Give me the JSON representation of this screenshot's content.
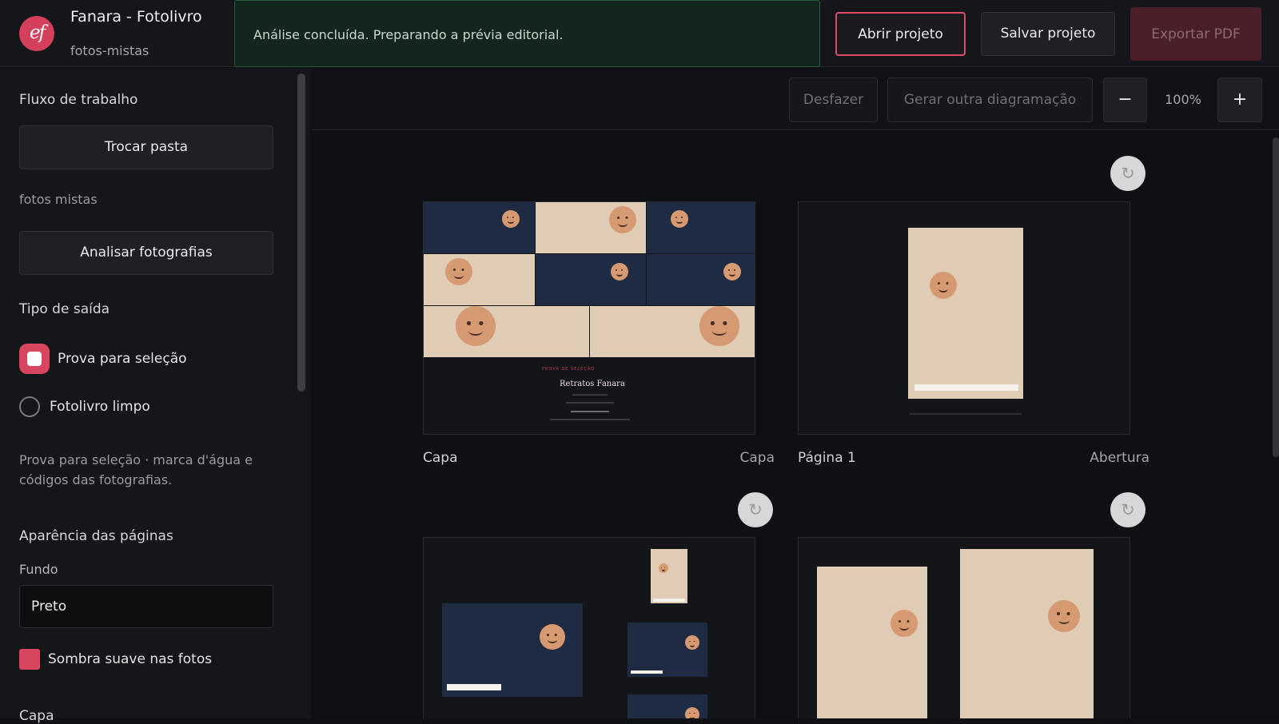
{
  "app": {
    "logo_text": "ef",
    "title": "Fanara - Fotolivro",
    "subtitle": "fotos-mistas"
  },
  "toast": {
    "message": "Análise concluída. Preparando a prévia editorial."
  },
  "header_actions": {
    "open": "Abrir projeto",
    "save": "Salvar projeto",
    "export": "Exportar PDF"
  },
  "sidebar": {
    "workflow_title": "Fluxo de trabalho",
    "change_folder": "Trocar pasta",
    "folder_name": "fotos mistas",
    "analyze": "Analisar fotografias",
    "output_title": "Tipo de saída",
    "output_options": [
      {
        "label": "Prova para seleção",
        "selected": true
      },
      {
        "label": "Fotolivro limpo",
        "selected": false
      }
    ],
    "output_help": "Prova para seleção · marca d'água e códigos das fotografias.",
    "appearance_title": "Aparência das páginas",
    "background_label": "Fundo",
    "background_value": "Preto",
    "shadow_label": "Sombra suave nas fotos",
    "shadow_checked": true,
    "next_section": "Capa"
  },
  "toolbar": {
    "undo": "Desfazer",
    "regenerate": "Gerar outra diagramação",
    "zoom_out": "−",
    "zoom_value": "100%",
    "zoom_in": "+"
  },
  "pages": [
    {
      "caption": "Capa",
      "kind": "Capa",
      "cover_kicker": "PROVA DE SELEÇÃO",
      "cover_title": "Retratos Fanara"
    },
    {
      "caption": "Página 1",
      "kind": "Abertura"
    },
    {
      "caption": "",
      "kind": ""
    },
    {
      "caption": "",
      "kind": ""
    }
  ],
  "icons": {
    "refresh": "refresh-icon"
  },
  "colors": {
    "accent": "#d8455f",
    "success_bg": "#13261d",
    "export_disabled": "#4b1f2a"
  }
}
